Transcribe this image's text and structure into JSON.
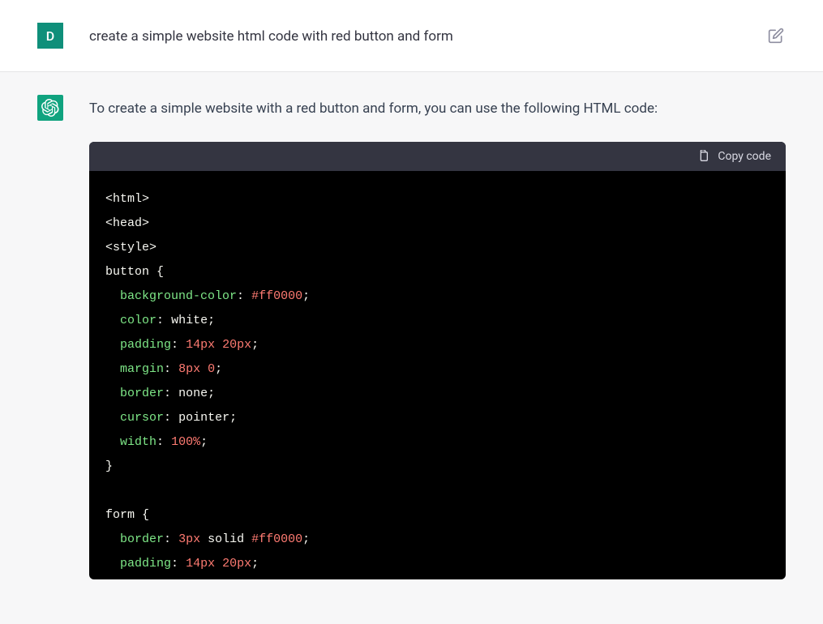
{
  "user": {
    "avatar_letter": "D",
    "text": "create a simple website html code with red button and form"
  },
  "assistant": {
    "text": "To create a simple website with a red button and form, you can use the following HTML code:"
  },
  "code_block": {
    "copy_label": "Copy code",
    "l1": "<html>",
    "l2": "<head>",
    "l3": "<style>",
    "l4_a": "button",
    "l4_b": "{",
    "l5_a": "background-color",
    "l5_b": ":",
    "l5_c": "#ff0000",
    "l5_d": ";",
    "l6_a": "color",
    "l6_b": ":",
    "l6_c": "white;",
    "l7_a": "padding",
    "l7_b": ":",
    "l7_c": "14px",
    "l7_d": "20px",
    "l7_e": ";",
    "l8_a": "margin",
    "l8_b": ":",
    "l8_c": "8px",
    "l8_d": "0",
    "l8_e": ";",
    "l9_a": "border",
    "l9_b": ":",
    "l9_c": "none;",
    "l10_a": "cursor",
    "l10_b": ":",
    "l10_c": "pointer;",
    "l11_a": "width",
    "l11_b": ":",
    "l11_c": "100%",
    "l11_d": ";",
    "l12": "}",
    "l13": "",
    "l14_a": "form",
    "l14_b": "{",
    "l15_a": "border",
    "l15_b": ":",
    "l15_c": "3px",
    "l15_d": "solid",
    "l15_e": "#ff0000",
    "l15_f": ";",
    "l16_a": "padding",
    "l16_b": ":",
    "l16_c": "14px",
    "l16_d": "20px",
    "l16_e": ";"
  }
}
